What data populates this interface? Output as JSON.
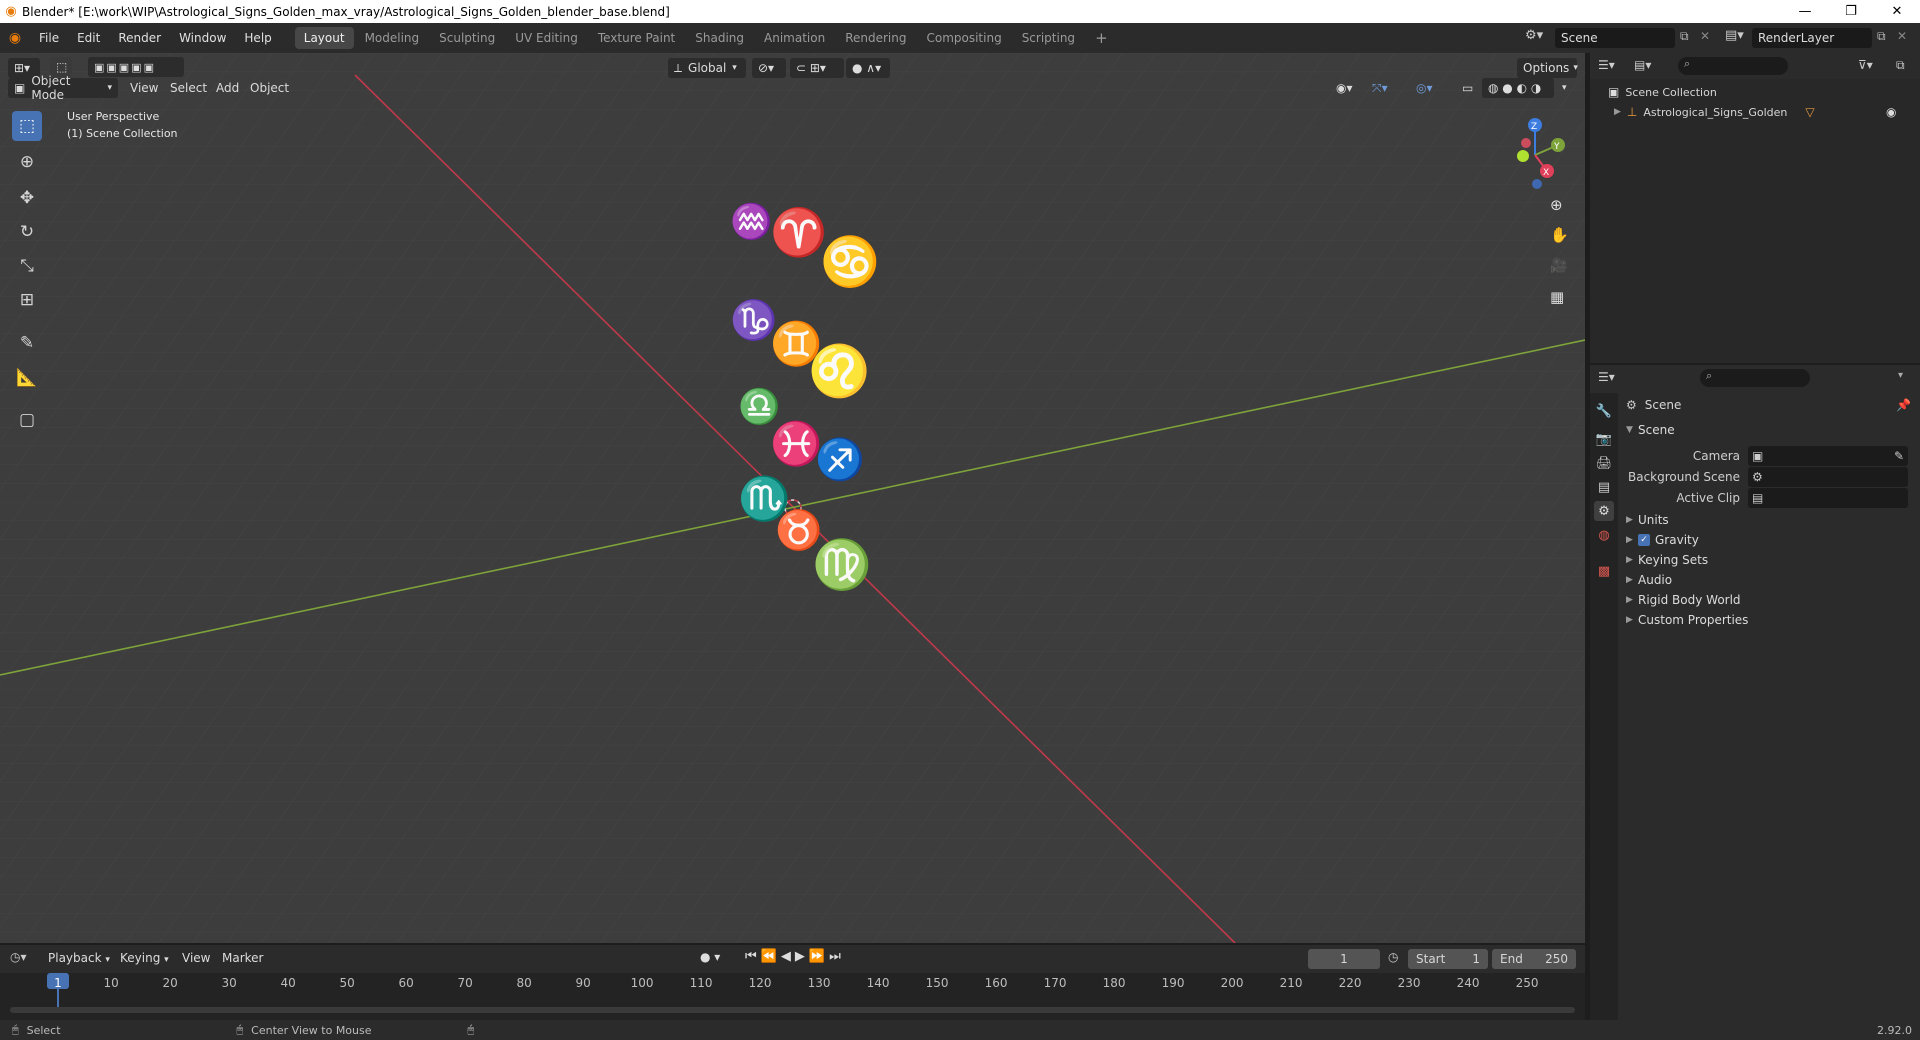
{
  "window": {
    "title": "Blender* [E:\\work\\WIP\\Astrological_Signs_Golden_max_vray/Astrological_Signs_Golden_blender_base.blend]",
    "controls": [
      "—",
      "❐",
      "✕"
    ]
  },
  "menubar": {
    "items": [
      "File",
      "Edit",
      "Render",
      "Window",
      "Help"
    ]
  },
  "workspaces": [
    "Layout",
    "Modeling",
    "Sculpting",
    "UV Editing",
    "Texture Paint",
    "Shading",
    "Animation",
    "Rendering",
    "Compositing",
    "Scripting"
  ],
  "active_workspace": "Layout",
  "scene_selector": {
    "value": "Scene"
  },
  "renderlayer_selector": {
    "value": "RenderLayer"
  },
  "viewport": {
    "mode": "Object Mode",
    "menus": [
      "View",
      "Select",
      "Add",
      "Object"
    ],
    "transform_orientation": "Global",
    "options_label": "Options",
    "overlay_text_1": "User Perspective",
    "overlay_text_2": "(1) Scene Collection",
    "gizmo_axes": {
      "z": "Z",
      "y": "Y",
      "x": "X"
    }
  },
  "outliner": {
    "root": "Scene Collection",
    "items": [
      {
        "label": "Astrological_Signs_Golden"
      }
    ]
  },
  "properties": {
    "context_title": "Scene",
    "section_scene": "Scene",
    "camera_label": "Camera",
    "background_scene_label": "Background Scene",
    "active_clip_label": "Active Clip",
    "panels": [
      "Units",
      "Gravity",
      "Keying Sets",
      "Audio",
      "Rigid Body World",
      "Custom Properties"
    ],
    "gravity_checked": true
  },
  "timeline": {
    "menus": [
      "Playback",
      "Keying",
      "View",
      "Marker"
    ],
    "current_frame": "1",
    "start_label": "Start",
    "start_value": "1",
    "end_label": "End",
    "end_value": "250",
    "ticks": [
      "1",
      "10",
      "20",
      "30",
      "40",
      "50",
      "60",
      "70",
      "80",
      "90",
      "100",
      "110",
      "120",
      "130",
      "140",
      "150",
      "160",
      "170",
      "180",
      "190",
      "200",
      "210",
      "220",
      "230",
      "240",
      "250"
    ]
  },
  "statusbar": {
    "select": "Select",
    "center_view": "Center View to Mouse",
    "version": "2.92.0"
  },
  "colors": {
    "accent": "#4772b3",
    "x_axis": "#c0394a",
    "y_axis": "#7da33a",
    "viewport_bg": "#3d3d3d"
  }
}
